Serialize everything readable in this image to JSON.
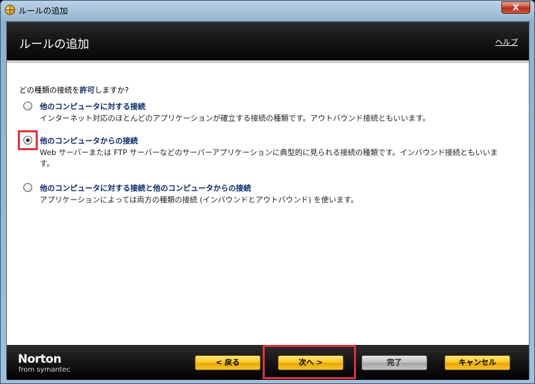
{
  "window": {
    "title": "ルールの追加",
    "close_label": "X"
  },
  "header": {
    "title": "ルールの追加",
    "help_label": "ヘルプ"
  },
  "question": {
    "prefix": "どの種類の接続を",
    "emphasis": "許可",
    "suffix": "しますか?"
  },
  "options": [
    {
      "title": "他のコンピュータに対する接続",
      "description": "インターネット対応のほとんどのアプリケーションが確立する接続の種類です。アウトバウンド接続ともいいます。",
      "selected": false
    },
    {
      "title": "他のコンピュータからの接続",
      "description": "Web サーバーまたは FTP サーバーなどのサーバーアプリケーションに典型的に見られる接続の種類です。インバウンド接続ともいいま",
      "description2": "す。",
      "selected": true
    },
    {
      "title": "他のコンピュータに対する接続と他のコンピュータからの接続",
      "description": "アプリケーションによっては両方の種類の接続 (インバウンドとアウトバウンド) を使います。",
      "selected": false
    }
  ],
  "footer": {
    "logo": "Norton",
    "logo_sub": "from symantec",
    "back_label": "< 戻る",
    "next_label": "次へ >",
    "finish_label": "完了",
    "cancel_label": "キャンセル"
  },
  "colors": {
    "accent_blue": "#0a2b6a",
    "highlight_red": "#e0313d",
    "button_gold": "#f7c51a"
  }
}
